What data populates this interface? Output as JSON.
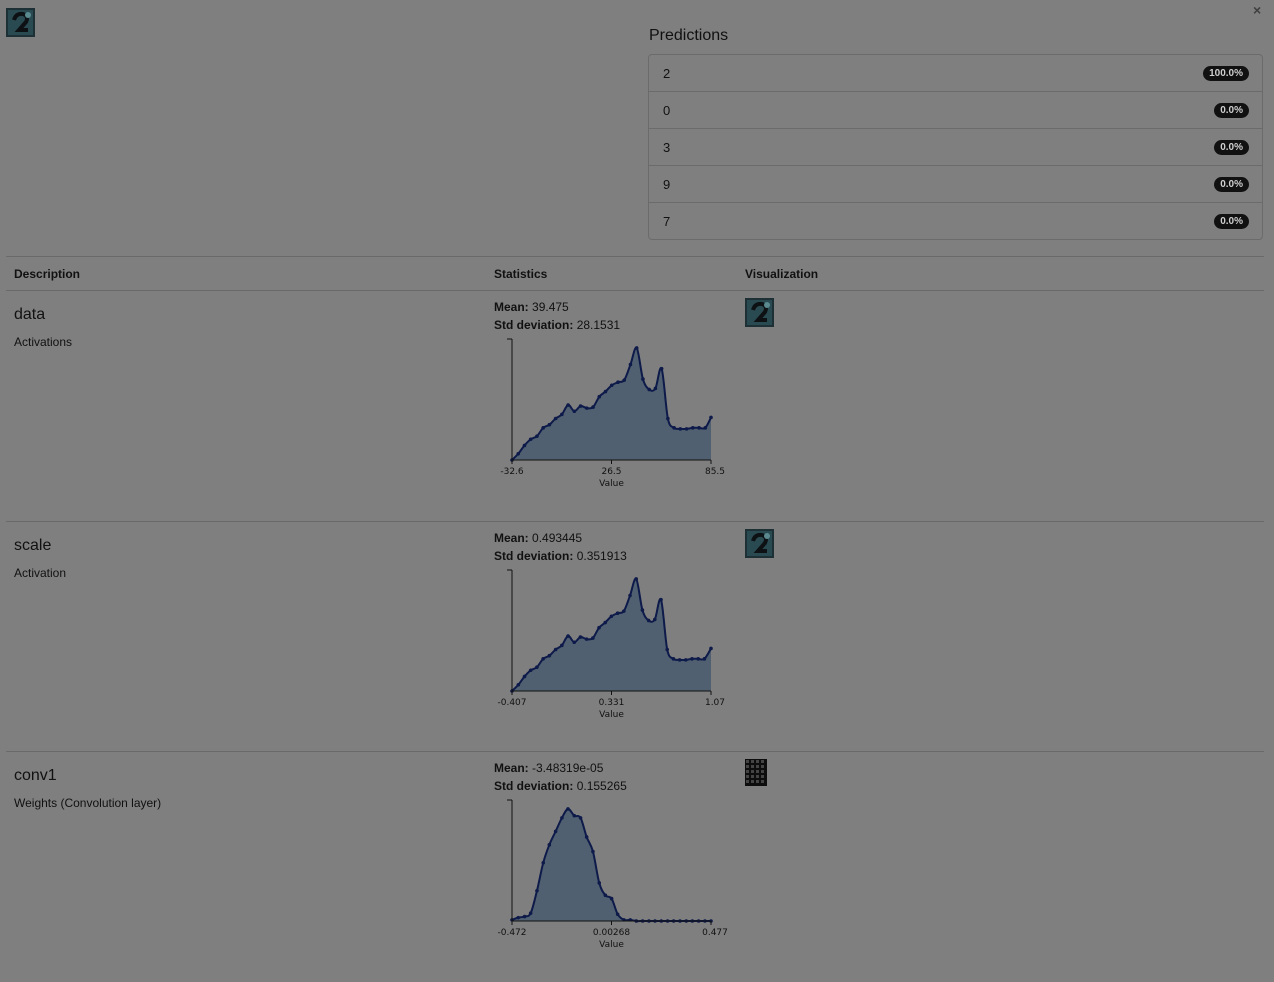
{
  "close_label": "×",
  "input_icon": "input-image-thumbnail",
  "predictions": {
    "title": "Predictions",
    "items": [
      {
        "label": "2",
        "value": "100.0%"
      },
      {
        "label": "0",
        "value": "0.0%"
      },
      {
        "label": "3",
        "value": "0.0%"
      },
      {
        "label": "9",
        "value": "0.0%"
      },
      {
        "label": "7",
        "value": "0.0%"
      }
    ]
  },
  "table": {
    "headers": {
      "description": "Description",
      "statistics": "Statistics",
      "visualization": "Visualization"
    }
  },
  "labels": {
    "mean": "Mean:",
    "std": "Std deviation:",
    "axis": "Value"
  },
  "layers": [
    {
      "name": "data",
      "type": "Activations",
      "mean": "39.475",
      "std": "28.1531",
      "visualization": "activation-image",
      "ticks": [
        "-32.6",
        "26.5",
        "85.5"
      ]
    },
    {
      "name": "scale",
      "type": "Activation",
      "mean": "0.493445",
      "std": "0.351913",
      "visualization": "activation-image",
      "ticks": [
        "-0.407",
        "0.331",
        "1.07"
      ]
    },
    {
      "name": "conv1",
      "type": "Weights (Convolution layer)",
      "mean": "-3.48319e-05",
      "std": "0.155265",
      "visualization": "weights-grid",
      "ticks": [
        "-0.472",
        "0.00268",
        "0.477"
      ]
    }
  ],
  "chart_data": [
    {
      "type": "area",
      "xlabel": "Value",
      "xlim": [
        -32.6,
        85.5
      ],
      "x": [
        -32.6,
        -28.9,
        -25.2,
        -21.5,
        -17.8,
        -14.1,
        -10.4,
        -6.7,
        -3.0,
        0.7,
        4.4,
        8.1,
        11.8,
        15.5,
        19.2,
        22.9,
        26.6,
        30.3,
        34.0,
        37.7,
        41.4,
        45.1,
        48.8,
        52.5,
        56.2,
        59.9,
        63.6,
        67.3,
        71.0,
        74.7,
        78.4,
        82.1,
        85.5
      ],
      "values": [
        0,
        6,
        14,
        20,
        23,
        31,
        34,
        40,
        44,
        53,
        47,
        52,
        50,
        51,
        61,
        66,
        72,
        75,
        77,
        92,
        108,
        78,
        68,
        69,
        88,
        40,
        31,
        30,
        30,
        31,
        31,
        31,
        41
      ]
    },
    {
      "type": "area",
      "xlabel": "Value",
      "xlim": [
        -0.407,
        1.07
      ],
      "x": [
        -0.407,
        -0.36,
        -0.314,
        -0.268,
        -0.222,
        -0.176,
        -0.13,
        -0.083,
        -0.037,
        0.009,
        0.055,
        0.101,
        0.147,
        0.193,
        0.239,
        0.285,
        0.331,
        0.377,
        0.423,
        0.469,
        0.515,
        0.561,
        0.607,
        0.653,
        0.699,
        0.745,
        0.791,
        0.837,
        0.883,
        0.929,
        0.975,
        1.021,
        1.07
      ],
      "values": [
        0,
        6,
        14,
        20,
        23,
        31,
        34,
        40,
        44,
        53,
        47,
        52,
        50,
        51,
        61,
        66,
        72,
        75,
        77,
        92,
        108,
        78,
        68,
        69,
        88,
        40,
        31,
        30,
        30,
        31,
        31,
        31,
        41
      ]
    },
    {
      "type": "area",
      "xlabel": "Value",
      "xlim": [
        -0.472,
        0.477
      ],
      "x": [
        -0.472,
        -0.442,
        -0.412,
        -0.383,
        -0.353,
        -0.323,
        -0.294,
        -0.264,
        -0.234,
        -0.205,
        -0.175,
        -0.145,
        -0.116,
        -0.086,
        -0.056,
        -0.027,
        0.003,
        0.032,
        0.062,
        0.092,
        0.121,
        0.151,
        0.181,
        0.21,
        0.24,
        0.27,
        0.299,
        0.329,
        0.359,
        0.388,
        0.418,
        0.448,
        0.477
      ],
      "values": [
        1,
        3,
        4,
        7,
        27,
        52,
        68,
        80,
        92,
        100,
        94,
        92,
        75,
        62,
        34,
        23,
        20,
        6,
        1,
        1,
        0,
        0,
        0,
        0,
        0,
        0,
        0,
        0,
        0,
        0,
        0,
        0,
        0
      ]
    }
  ]
}
